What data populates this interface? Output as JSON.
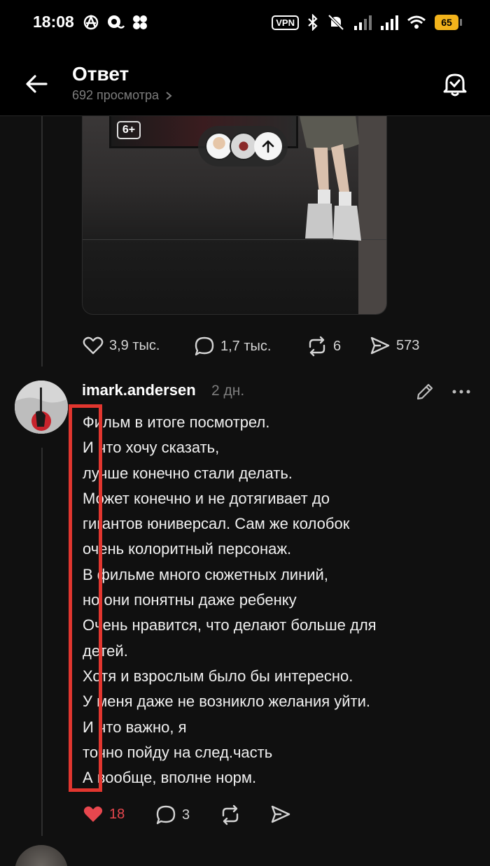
{
  "status_bar": {
    "time": "18:08",
    "vpn": "VPN",
    "battery": "65",
    "icons": [
      "anarchy-icon",
      "chat-app-icon",
      "dots-cluster-icon",
      "bluetooth-icon",
      "mute-icon",
      "signal-icon",
      "signal-icon",
      "wifi-icon"
    ]
  },
  "header": {
    "title": "Ответ",
    "views": "692 просмотра"
  },
  "post": {
    "poster_badge": "6+",
    "actions": {
      "likes": "3,9 тыс.",
      "comments": "1,7 тыс.",
      "reposts": "6",
      "shares": "573"
    }
  },
  "comment": {
    "author": "imark.andersen",
    "time": "2 дн.",
    "lines": [
      "Фильм в итоге посмотрел.",
      "И что хочу сказать,",
      "лучше конечно стали делать.",
      "Может конечно и не дотягивает до",
      "гигантов юниверсал. Сам же колобок",
      "очень колоритный персонаж.",
      "В фильме много сюжетных линий,",
      "но они понятны даже ребенку",
      "Очень нравится, что делают больше для",
      "детей.",
      "Хотя и взрослым было бы интересно.",
      "У меня даже не возникло желания уйти.",
      "И что важно, я",
      "точно пойду на след.часть",
      "А вообще, вполне норм."
    ],
    "likes": "18",
    "replies": "3"
  },
  "colors": {
    "background": "#101010",
    "liked_red": "#e8474e",
    "highlight_red": "#e2362f",
    "muted_text": "#7d7d7d"
  }
}
